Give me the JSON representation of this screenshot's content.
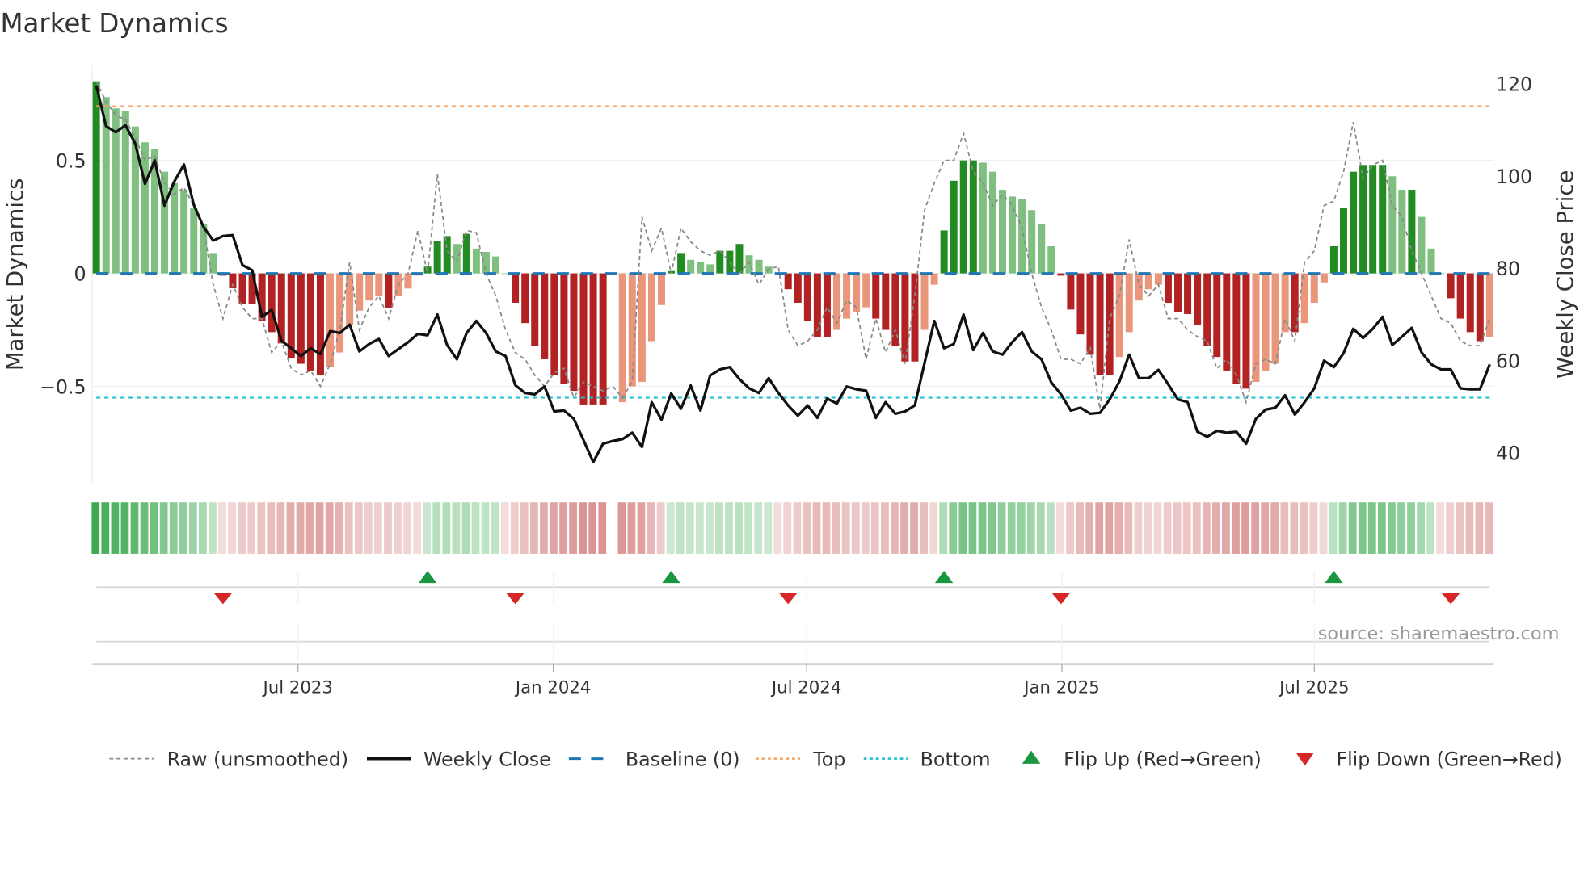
{
  "chart_data": {
    "type": "bar",
    "title": "Market Dynamics",
    "ylabel": "Market Dynamics",
    "ylabel_right": "Weekly Close Price",
    "ylim": [
      -0.93,
      0.92
    ],
    "ylim_right": [
      40,
      122
    ],
    "yticks": [
      {
        "v": 0.5,
        "label": "0.5"
      },
      {
        "v": 0,
        "label": "0"
      },
      {
        "v": -0.5,
        "label": "−0.5"
      }
    ],
    "yticks_right": [
      {
        "v": 120,
        "label": "120"
      },
      {
        "v": 100,
        "label": "100"
      },
      {
        "v": 80,
        "label": "80"
      },
      {
        "v": 60,
        "label": "60"
      },
      {
        "v": 40,
        "label": "40"
      }
    ],
    "top_level": 0.74,
    "bottom_level": -0.55,
    "baseline": 0,
    "x_ticks": [
      {
        "week": 20.7,
        "label": "Jul 2023"
      },
      {
        "week": 46.9,
        "label": "Jan 2024"
      },
      {
        "week": 72.9,
        "label": "Jul 2024"
      },
      {
        "week": 99.1,
        "label": "Jan 2025"
      },
      {
        "week": 125,
        "label": "Jul 2025"
      }
    ],
    "momentum": [
      0.85,
      0.78,
      0.73,
      0.72,
      0.65,
      0.58,
      0.55,
      0.45,
      0.4,
      0.37,
      0.29,
      0.22,
      0.09,
      -0.01,
      -0.066,
      -0.135,
      -0.135,
      -0.21,
      -0.26,
      -0.31,
      -0.375,
      -0.4,
      -0.43,
      -0.45,
      -0.415,
      -0.35,
      -0.23,
      -0.165,
      -0.12,
      -0.1,
      -0.155,
      -0.1,
      -0.067,
      -0.01,
      0.03,
      0.145,
      0.165,
      0.13,
      0.175,
      0.11,
      0.095,
      0.075,
      0.0,
      -0.13,
      -0.22,
      -0.32,
      -0.38,
      -0.45,
      -0.49,
      -0.52,
      -0.58,
      -0.58,
      -0.58,
      null,
      -0.57,
      -0.5,
      -0.48,
      -0.3,
      -0.14,
      0.01,
      0.09,
      0.06,
      0.05,
      0.04,
      0.1,
      0.1,
      0.13,
      0.08,
      0.06,
      0.03,
      0.0,
      -0.07,
      -0.13,
      -0.21,
      -0.28,
      -0.28,
      -0.25,
      -0.2,
      -0.17,
      -0.15,
      -0.2,
      -0.25,
      -0.32,
      -0.39,
      -0.39,
      -0.25,
      -0.05,
      0.19,
      0.41,
      0.5,
      0.5,
      0.49,
      0.45,
      0.37,
      0.34,
      0.33,
      0.28,
      0.22,
      0.12,
      -0.01,
      -0.16,
      -0.27,
      -0.36,
      -0.45,
      -0.45,
      -0.37,
      -0.26,
      -0.12,
      -0.07,
      -0.05,
      -0.13,
      -0.17,
      -0.18,
      -0.23,
      -0.32,
      -0.37,
      -0.43,
      -0.49,
      -0.51,
      -0.48,
      -0.43,
      -0.4,
      -0.26,
      -0.26,
      -0.22,
      -0.13,
      -0.04,
      0.12,
      0.29,
      0.45,
      0.48,
      0.48,
      0.48,
      0.43,
      0.37,
      0.37,
      0.25,
      0.11,
      0.0,
      -0.11,
      -0.2,
      -0.26,
      -0.3,
      -0.28
    ],
    "raw": [
      0.85,
      0.76,
      0.7,
      0.68,
      0.6,
      0.5,
      0.52,
      0.4,
      0.35,
      0.38,
      0.3,
      0.2,
      -0.05,
      -0.2,
      -0.05,
      -0.15,
      -0.2,
      -0.2,
      -0.35,
      -0.3,
      -0.42,
      -0.45,
      -0.43,
      -0.5,
      -0.4,
      -0.25,
      0.05,
      -0.25,
      -0.15,
      -0.1,
      -0.2,
      -0.05,
      0.0,
      0.19,
      0.0,
      0.44,
      0.1,
      0.05,
      0.19,
      0.18,
      0.0,
      -0.1,
      -0.25,
      -0.35,
      -0.38,
      -0.45,
      -0.5,
      -0.44,
      -0.42,
      -0.55,
      -0.48,
      -0.5,
      -0.52,
      -0.5,
      -0.55,
      -0.48,
      0.25,
      0.1,
      0.2,
      0.0,
      0.2,
      0.14,
      0.1,
      0.08,
      0.1,
      0.05,
      0.0,
      0.05,
      -0.05,
      0.02,
      0.03,
      -0.25,
      -0.32,
      -0.3,
      -0.25,
      -0.15,
      -0.22,
      -0.12,
      -0.15,
      -0.38,
      -0.2,
      -0.35,
      -0.25,
      -0.4,
      -0.1,
      0.28,
      0.4,
      0.5,
      0.5,
      0.62,
      0.45,
      0.4,
      0.3,
      0.35,
      0.3,
      0.2,
      0.0,
      -0.15,
      -0.25,
      -0.38,
      -0.38,
      -0.4,
      -0.33,
      -0.6,
      -0.2,
      -0.1,
      0.15,
      -0.05,
      -0.1,
      -0.05,
      -0.2,
      -0.2,
      -0.25,
      -0.28,
      -0.3,
      -0.42,
      -0.38,
      -0.45,
      -0.57,
      -0.4,
      -0.38,
      -0.4,
      -0.2,
      -0.3,
      0.05,
      0.1,
      0.3,
      0.32,
      0.45,
      0.67,
      0.42,
      0.48,
      0.5,
      0.3,
      0.25,
      0.1,
      0.0,
      -0.1,
      -0.2,
      -0.22,
      -0.3,
      -0.32,
      -0.32,
      -0.2
    ],
    "price": [
      119.6,
      110.8,
      109.5,
      111,
      107,
      98.3,
      103.4,
      93.6,
      98.8,
      102.5,
      93.8,
      89,
      86,
      87,
      87.2,
      80.7,
      79.6,
      69.5,
      71,
      64.3,
      62.7,
      61,
      62.7,
      61.4,
      66.4,
      66,
      67.8,
      62,
      63.6,
      64.7,
      61,
      62.5,
      64,
      65.8,
      65.5,
      70,
      63.4,
      60.3,
      66,
      68.6,
      66,
      62,
      61,
      54.7,
      53,
      52.7,
      54.4,
      49,
      49.2,
      47.4,
      42.8,
      38,
      42,
      42.6,
      43,
      44.4,
      41.3,
      51,
      47.2,
      52.9,
      49.6,
      54.6,
      49.2,
      56.8,
      58.1,
      58.6,
      56,
      54,
      53,
      56.2,
      53,
      50.3,
      48.1,
      50.3,
      47.6,
      51.8,
      50.7,
      54.4,
      53.8,
      53.5,
      47.6,
      51,
      48.5,
      49,
      50.3,
      59.5,
      68.6,
      62.7,
      63.6,
      70,
      62.3,
      66,
      62,
      61.3,
      64,
      66.2,
      62,
      60.3,
      55.3,
      52.7,
      49.2,
      49.8,
      48.5,
      48.7,
      51.6,
      55.5,
      61.3,
      56.2,
      56.2,
      58,
      54.9,
      51.6,
      51,
      44.6,
      43.5,
      44.8,
      44.4,
      44.6,
      42,
      47.4,
      49.4,
      49.8,
      52.5,
      48.3,
      51,
      54,
      60,
      58.6,
      61.6,
      66.9,
      64.9,
      66.9,
      69.5,
      63.4,
      65.2,
      67.1,
      61.8,
      59.2,
      58.1,
      58.1,
      54,
      53.8,
      53.8,
      59.2
    ],
    "flip_up_weeks": [
      34,
      59,
      87,
      127
    ],
    "flip_down_weeks": [
      13,
      43,
      71,
      99,
      139
    ],
    "colors": {
      "pos_rising": "#228b22",
      "pos_falling": "#7fbf7f",
      "neg_falling": "#b22222",
      "neg_rising": "#e9967a",
      "flip_up": "#1a9641",
      "flip_down": "#d62728",
      "top": "#f4a460",
      "bottom": "#17becf",
      "baseline": "#1f77b4"
    },
    "legend": [
      "Raw (unsmoothed)",
      "Weekly Close",
      "Baseline (0)",
      "Top",
      "Bottom",
      "Flip Up (Red→Green)",
      "Flip Down (Green→Red)"
    ],
    "source": "source: sharemaestro.com"
  }
}
